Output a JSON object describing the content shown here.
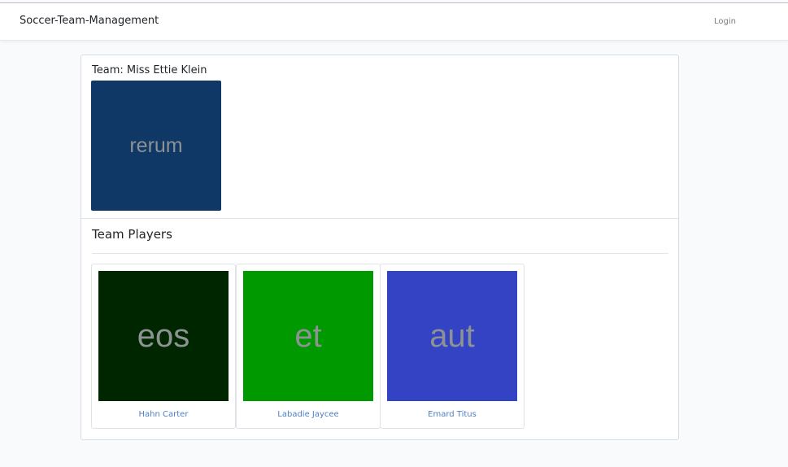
{
  "navbar": {
    "brand": "Soccer-Team-Management",
    "login": "Login"
  },
  "team": {
    "title": "Team: Miss Ettie Klein",
    "logo_text": "rerum",
    "logo_color": "#0f3866"
  },
  "players_section": {
    "title": "Team Players",
    "players": [
      {
        "name": "Hahn Carter",
        "image_text": "eos",
        "image_color": "#002600"
      },
      {
        "name": "Labadie Jaycee",
        "image_text": "et",
        "image_color": "#009a00"
      },
      {
        "name": "Emard Titus",
        "image_text": "aut",
        "image_color": "#3442c4"
      }
    ]
  },
  "colors": {
    "link": "#4f7fc4",
    "page_background": "#f8fafc"
  }
}
